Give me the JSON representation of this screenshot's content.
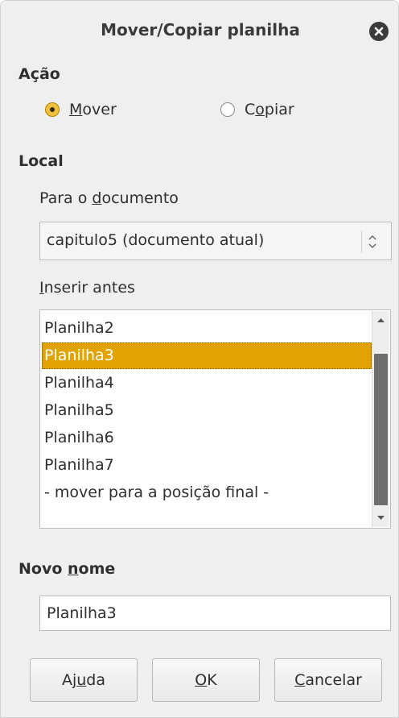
{
  "dialog": {
    "title": "Mover/Copiar planilha"
  },
  "acao": {
    "heading": "Ação",
    "options": [
      {
        "pre": "",
        "accel": "M",
        "post": "over",
        "checked": true
      },
      {
        "pre": "C",
        "accel": "o",
        "post": "piar",
        "checked": false
      }
    ]
  },
  "local": {
    "heading": "Local",
    "doc_label": {
      "pre": "Para o ",
      "accel": "d",
      "post": "ocumento"
    },
    "doc_value": "capitulo5 (documento atual)",
    "insert_label": {
      "pre": "",
      "accel": "I",
      "post": "nserir antes"
    },
    "items": [
      "Planilha2",
      "Planilha3",
      "Planilha4",
      "Planilha5",
      "Planilha6",
      "Planilha7",
      "- mover para a posição final -"
    ],
    "selected_item": "Planilha3"
  },
  "novo_nome": {
    "label": {
      "pre": "Novo ",
      "accel": "n",
      "post": "ome"
    },
    "value": "Planilha3"
  },
  "buttons": {
    "help": {
      "pre": "Aj",
      "accel": "u",
      "post": "da"
    },
    "ok": {
      "pre": "",
      "accel": "O",
      "post": "K"
    },
    "cancel": {
      "pre": "",
      "accel": "C",
      "post": "ancelar"
    }
  },
  "colors": {
    "accent": "#e0a300",
    "background": "#efefef"
  },
  "icons": {
    "close": "close-icon",
    "spin": "spin-arrows-icon",
    "scroll_up": "chevron-up-icon",
    "scroll_down": "chevron-down-icon"
  }
}
